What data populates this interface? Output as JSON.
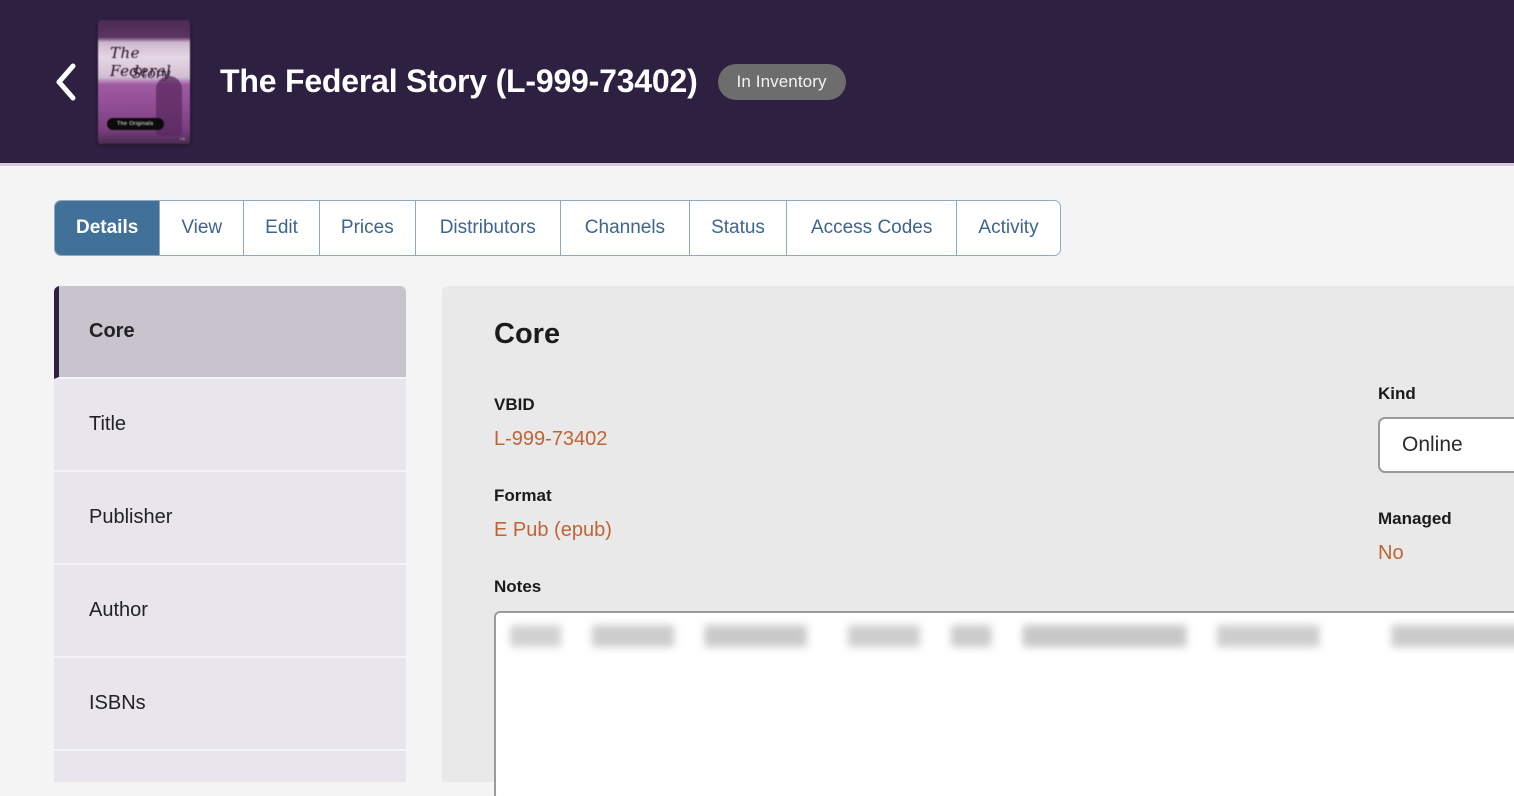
{
  "header": {
    "back_icon": "chevron-left-icon",
    "cover": {
      "title_line1": "The Federal",
      "title_line2": "Story",
      "series_pill": "The Originals",
      "corner_mark": "LB"
    },
    "title": "The Federal Story (L-999-73402)",
    "status_badge": "In Inventory",
    "background_color": "#2e2040"
  },
  "tabs": {
    "items": [
      {
        "label": "Details",
        "active": true
      },
      {
        "label": "View",
        "active": false
      },
      {
        "label": "Edit",
        "active": false
      },
      {
        "label": "Prices",
        "active": false
      },
      {
        "label": "Distributors",
        "active": false
      },
      {
        "label": "Channels",
        "active": false
      },
      {
        "label": "Status",
        "active": false
      },
      {
        "label": "Access Codes",
        "active": false,
        "highlighted": true
      },
      {
        "label": "Activity",
        "active": false
      }
    ],
    "active_color": "#417199",
    "highlight_color": "#e8862a"
  },
  "sidebar": {
    "items": [
      {
        "label": "Core",
        "active": true
      },
      {
        "label": "Title",
        "active": false
      },
      {
        "label": "Publisher",
        "active": false
      },
      {
        "label": "Author",
        "active": false
      },
      {
        "label": "ISBNs",
        "active": false
      }
    ]
  },
  "main": {
    "heading": "Core",
    "fields": {
      "vbid_label": "VBID",
      "vbid_value": "L-999-73402",
      "format_label": "Format",
      "format_value": "E Pub (epub)",
      "notes_label": "Notes",
      "notes_value": ""
    },
    "right_fields": {
      "kind_label": "Kind",
      "kind_value": "Online",
      "managed_label": "Managed",
      "managed_value": "No"
    },
    "value_color": "#bf6434"
  }
}
